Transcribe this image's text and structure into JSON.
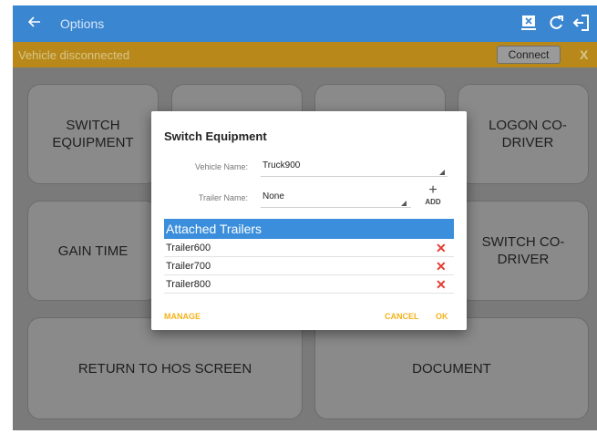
{
  "appbar": {
    "title": "Options",
    "back_icon": "arrow-left-icon",
    "actions": [
      "bluetooth-device-icon",
      "refresh-icon",
      "logout-icon"
    ]
  },
  "status": {
    "message": "Vehicle disconnected",
    "connect_label": "Connect",
    "close_label": "X"
  },
  "tiles": {
    "switch_equipment": "SWITCH EQUIPMENT",
    "logon_codriver": "LOGON CO-DRIVER",
    "gain_time": "GAIN TIME",
    "switch_codriver": "SWITCH CO-DRIVER",
    "return_hos": "RETURN TO HOS SCREEN",
    "document": "DOCUMENT"
  },
  "dialog": {
    "title": "Switch Equipment",
    "vehicle_label": "Vehicle Name:",
    "vehicle_value": "Truck900",
    "trailer_label": "Trailer Name:",
    "trailer_value": "None",
    "add_label": "ADD",
    "attached_header": "Attached Trailers",
    "trailers": [
      "Trailer600",
      "Trailer700",
      "Trailer800"
    ],
    "manage_label": "MANAGE",
    "cancel_label": "CANCEL",
    "ok_label": "OK"
  },
  "colors": {
    "appbar": "#3a86d1",
    "statusbar": "#b8891a",
    "accent": "#f2b21a",
    "delete": "#e53b2f",
    "header": "#3a8edb"
  }
}
